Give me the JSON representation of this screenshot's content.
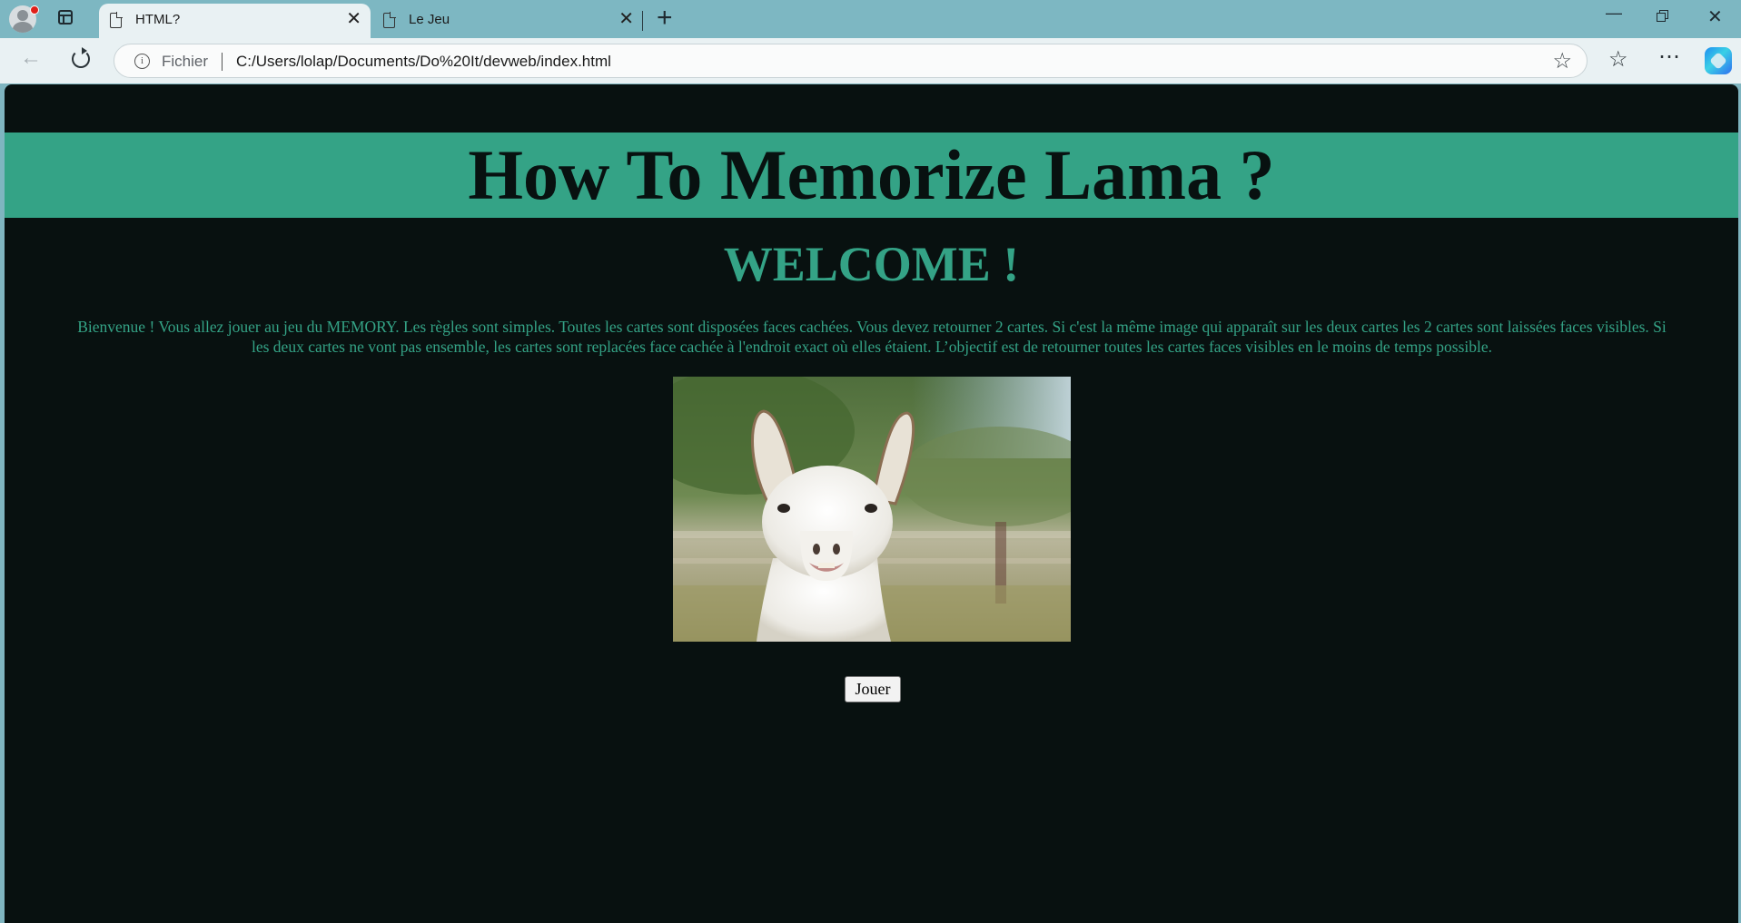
{
  "browser": {
    "tabs": [
      {
        "title": "HTML?",
        "active": true
      },
      {
        "title": "Le Jeu",
        "active": false
      }
    ],
    "new_tab_glyph": "+",
    "close_glyph": "✕",
    "address": {
      "scheme_label": "Fichier",
      "url": "C:/Users/lolap/Documents/Do%20It/devweb/index.html"
    },
    "icons": [
      "profile-avatar",
      "tab-actions-icon",
      "doc-icon",
      "back-icon",
      "reload-icon",
      "info-icon",
      "favorite-star-icon",
      "favorites-icon",
      "more-icon",
      "copilot-icon",
      "minimize-icon",
      "restore-icon",
      "close-icon"
    ]
  },
  "page": {
    "banner_title": "How To Memorize Lama ?",
    "welcome": "WELCOME !",
    "intro": "Bienvenue ! Vous allez jouer au jeu du MEMORY. Les règles sont simples. Toutes les cartes sont disposées faces cachées. Vous devez retourner 2 cartes. Si c'est la même image qui apparaît sur les deux cartes les 2 cartes sont laissées faces visibles. Si les deux cartes ne vont pas ensemble, les cartes sont replacées face cachée à l'endroit exact où elles étaient. L’objectif est de retourner toutes les cartes faces visibles en le moins de temps possible.",
    "image_subject": "llama",
    "play_button": "Jouer"
  },
  "colors": {
    "page_bg": "#081110",
    "accent": "#34a386",
    "tabstrip": "#7db7c2",
    "toolbar": "#e9f1f3"
  }
}
